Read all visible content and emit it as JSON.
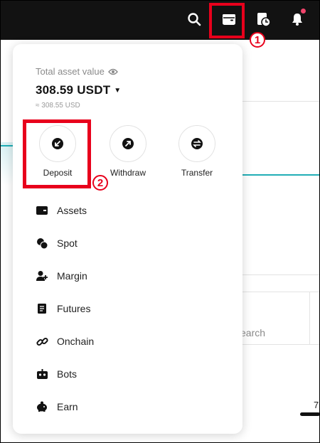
{
  "header": {
    "icons": [
      "search-icon",
      "wallet-icon",
      "order-history-icon",
      "bell-icon"
    ],
    "bell_has_notification": true
  },
  "annotations": {
    "step1": "1",
    "step2": "2",
    "color": "#e8001c"
  },
  "wallet_panel": {
    "title": "Total asset value",
    "balance": "308.59",
    "currency": "USDT",
    "approx": "≈ 308.55 USD",
    "actions": [
      {
        "label": "Deposit",
        "icon": "deposit-arrow-icon"
      },
      {
        "label": "Withdraw",
        "icon": "withdraw-arrow-icon"
      },
      {
        "label": "Transfer",
        "icon": "transfer-arrows-icon"
      }
    ],
    "menu": [
      {
        "label": "Assets",
        "icon": "wallet-icon"
      },
      {
        "label": "Spot",
        "icon": "coins-icon"
      },
      {
        "label": "Margin",
        "icon": "margin-user-icon"
      },
      {
        "label": "Futures",
        "icon": "futures-doc-icon"
      },
      {
        "label": "Onchain",
        "icon": "chain-link-icon"
      },
      {
        "label": "Bots",
        "icon": "robot-icon"
      },
      {
        "label": "Earn",
        "icon": "piggy-bank-icon"
      }
    ]
  },
  "background": {
    "search_partial": "earch",
    "number_partial": "7",
    "accent": "#21aeb6"
  }
}
